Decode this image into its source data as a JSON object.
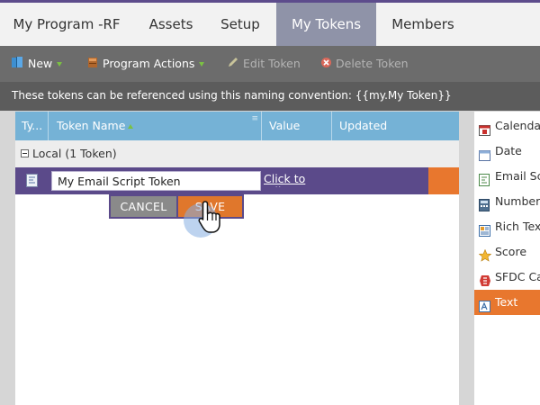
{
  "tabs": [
    {
      "label": "My Program -RF"
    },
    {
      "label": "Assets"
    },
    {
      "label": "Setup"
    },
    {
      "label": "My Tokens",
      "active": true
    },
    {
      "label": "Members"
    }
  ],
  "toolbar": {
    "new_label": "New",
    "program_actions_label": "Program Actions",
    "edit_token_label": "Edit Token",
    "delete_token_label": "Delete Token"
  },
  "info": {
    "text": "These tokens can be referenced using this naming convention: {{my.My Token}}"
  },
  "grid": {
    "columns": {
      "type": "Ty...",
      "token_name": "Token Name",
      "value": "Value",
      "updated": "Updated"
    },
    "group_label": "Local (1 Token)",
    "edit_row": {
      "token_name_value": "My Email Script Token",
      "value_link": "Click to Edit"
    },
    "cancel_label": "CANCEL",
    "save_label": "SAVE"
  },
  "token_types": [
    {
      "label": "Calendar Entry",
      "icon": "calendar-icon"
    },
    {
      "label": "Date",
      "icon": "date-icon"
    },
    {
      "label": "Email Script",
      "icon": "email-script-icon"
    },
    {
      "label": "Number",
      "icon": "number-icon"
    },
    {
      "label": "Rich Text",
      "icon": "rich-text-icon"
    },
    {
      "label": "Score",
      "icon": "star-icon"
    },
    {
      "label": "SFDC Campaign",
      "icon": "sfdc-icon"
    },
    {
      "label": "Text",
      "icon": "text-icon",
      "active": true
    }
  ],
  "colors": {
    "accent_purple": "#5b4a8a",
    "accent_orange": "#e8772e",
    "header_blue": "#75b2d6"
  }
}
